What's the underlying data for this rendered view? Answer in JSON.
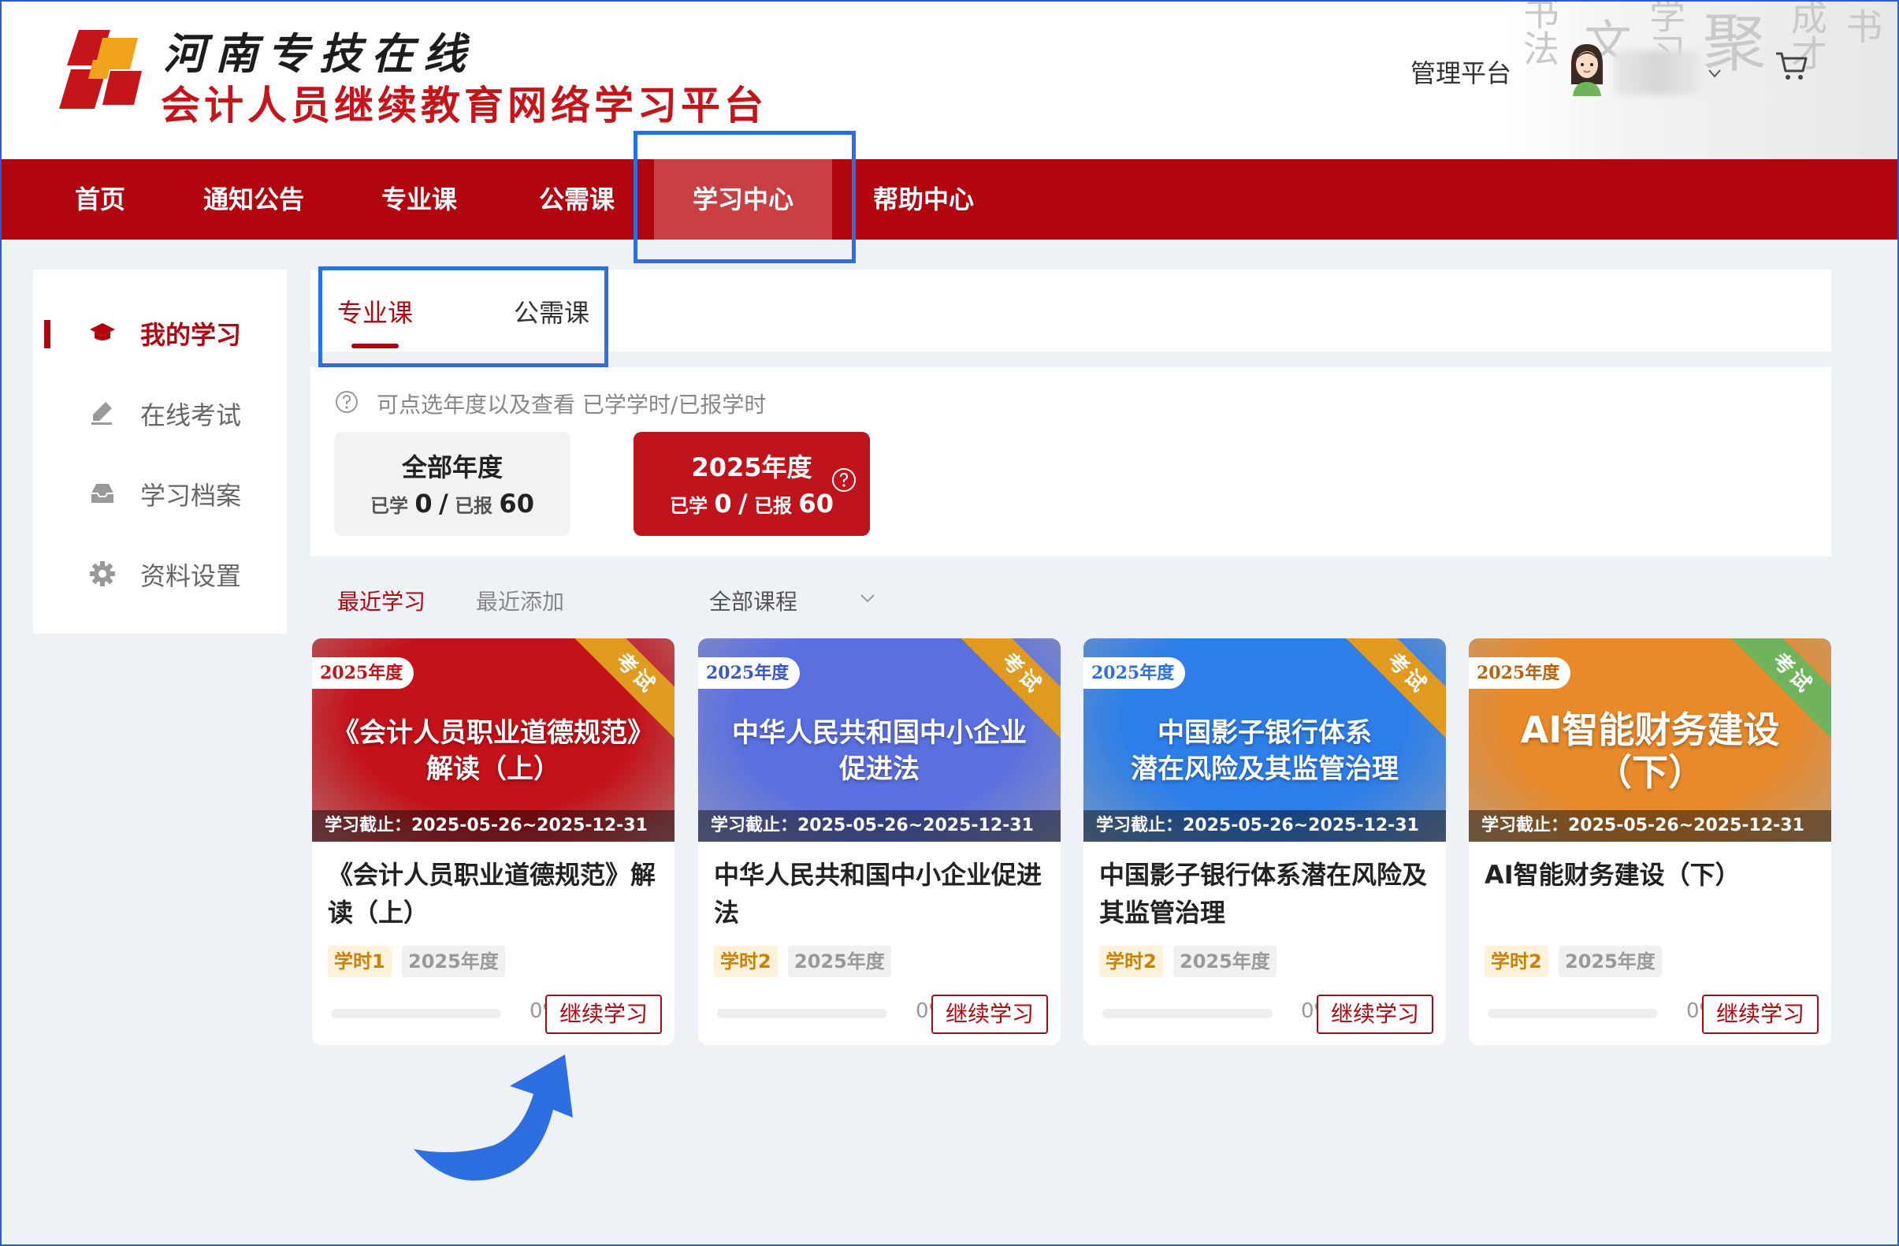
{
  "header": {
    "site_title": "河南专技在线",
    "platform_title": "会计人员继续教育网络学习平台",
    "admin_link": "管理平台",
    "icons": [
      "logo-mark",
      "avatar",
      "chevron-down-icon",
      "cart-icon"
    ]
  },
  "nav": {
    "items": [
      {
        "label": "首页"
      },
      {
        "label": "通知公告"
      },
      {
        "label": "专业课"
      },
      {
        "label": "公需课"
      },
      {
        "label": "学习中心",
        "active": true
      },
      {
        "label": "帮助中心"
      }
    ]
  },
  "sidebar": {
    "items": [
      {
        "label": "我的学习",
        "icon": "graduation-cap-icon",
        "active": true
      },
      {
        "label": "在线考试",
        "icon": "pen-icon"
      },
      {
        "label": "学习档案",
        "icon": "archive-icon"
      },
      {
        "label": "资料设置",
        "icon": "gear-icon"
      }
    ]
  },
  "tabs": {
    "items": [
      {
        "label": "专业课",
        "active": true
      },
      {
        "label": "公需课"
      }
    ]
  },
  "year_panel": {
    "hint": "可点选年度以及查看 已学学时/已报学时",
    "cards": [
      {
        "title": "全部年度",
        "learned_label": "已学",
        "learned": "0",
        "sep": "/",
        "reported_label": "已报",
        "reported": "60"
      },
      {
        "title": "2025年度",
        "learned_label": "已学",
        "learned": "0",
        "sep": "/",
        "reported_label": "已报",
        "reported": "60",
        "selected": true
      }
    ]
  },
  "filters": {
    "recent_study": "最近学习",
    "recent_added": "最近添加",
    "course_select": "全部课程"
  },
  "courses": [
    {
      "cover_year": "2025年度",
      "exam_badge": "考试",
      "cover_title_line1": "《会计人员职业道德规范》",
      "cover_title_line2": "解读（上）",
      "deadline": "学习截止：2025-05-26~2025-12-31",
      "title": "《会计人员职业道德规范》解读（上）",
      "hours_tag": "学时1",
      "year_tag": "2025年度",
      "progress": 0,
      "progress_label": "0%",
      "button": "继续学习",
      "cover_color": "#c4121a",
      "ribbon_color": "#e09a20"
    },
    {
      "cover_year": "2025年度",
      "exam_badge": "考试",
      "cover_title_line1": "中华人民共和国中小企业",
      "cover_title_line2": "促进法",
      "deadline": "学习截止：2025-05-26~2025-12-31",
      "title": "中华人民共和国中小企业促进法",
      "hours_tag": "学时2",
      "year_tag": "2025年度",
      "progress": 0,
      "progress_label": "0%",
      "button": "继续学习",
      "cover_color": "#5b70e0",
      "ribbon_color": "#e09a20"
    },
    {
      "cover_year": "2025年度",
      "exam_badge": "考试",
      "cover_title_line1": "中国影子银行体系",
      "cover_title_line2": "潜在风险及其监管治理",
      "deadline": "学习截止：2025-05-26~2025-12-31",
      "title": "中国影子银行体系潜在风险及其监管治理",
      "hours_tag": "学时2",
      "year_tag": "2025年度",
      "progress": 0,
      "progress_label": "0%",
      "button": "继续学习",
      "cover_color": "#2d7ee8",
      "ribbon_color": "#e09a20"
    },
    {
      "cover_year": "2025年度",
      "exam_badge": "考试",
      "cover_title_line1": "AI智能财务建设",
      "cover_title_line2": "（下）",
      "deadline": "学习截止：2025-05-26~2025-12-31",
      "title": "AI智能财务建设（下）",
      "hours_tag": "学时2",
      "year_tag": "2025年度",
      "progress": 0,
      "progress_label": "0%",
      "button": "继续学习",
      "cover_color": "#e8892a",
      "ribbon_color": "#6fb35a"
    }
  ],
  "colors": {
    "brand_red": "#b10610",
    "highlight_blue": "#2d6fe0",
    "nav_active": "#c84043"
  }
}
